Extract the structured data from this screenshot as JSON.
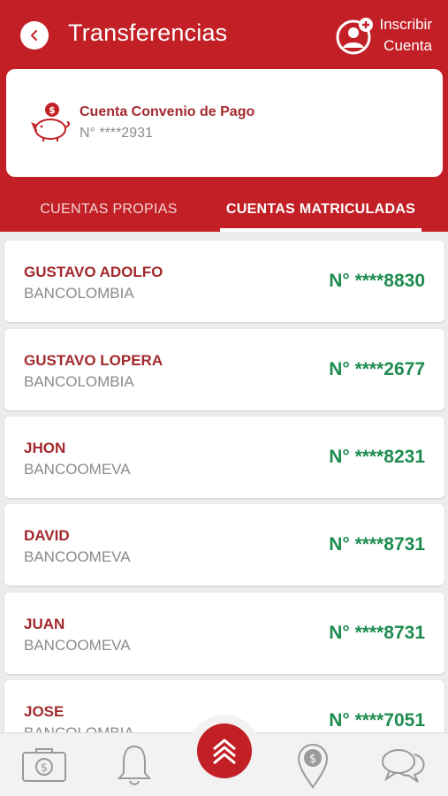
{
  "header": {
    "title": "Transferencias",
    "enroll_line1": "Inscribir",
    "enroll_line2": "Cuenta"
  },
  "account": {
    "name": "Cuenta Convenio de Pago",
    "number": "N° ****2931"
  },
  "tabs": [
    {
      "label": "CUENTAS PROPIAS",
      "active": false
    },
    {
      "label": "CUENTAS MATRICULADAS",
      "active": true
    }
  ],
  "accounts": [
    {
      "name": "GUSTAVO ADOLFO",
      "bank": "BANCOLOMBIA",
      "number": "N° ****8830"
    },
    {
      "name": "GUSTAVO LOPERA",
      "bank": "BANCOLOMBIA",
      "number": "N° ****2677"
    },
    {
      "name": "JHON",
      "bank": "BANCOOMEVA",
      "number": "N° ****8231"
    },
    {
      "name": "DAVID",
      "bank": "BANCOOMEVA",
      "number": "N° ****8731"
    },
    {
      "name": "JUAN",
      "bank": "BANCOOMEVA",
      "number": "N° ****8731"
    },
    {
      "name": "JOSE",
      "bank": "BANCOLOMBIA",
      "number": "N° ****7051"
    }
  ],
  "nav_icons": [
    "wallet-icon",
    "bell-icon",
    "menu-up-icon",
    "location-money-icon",
    "chat-icon"
  ],
  "colors": {
    "brand": "#c22026",
    "name": "#a32a2e",
    "number": "#1e8c50",
    "muted": "#8a8a8a"
  }
}
